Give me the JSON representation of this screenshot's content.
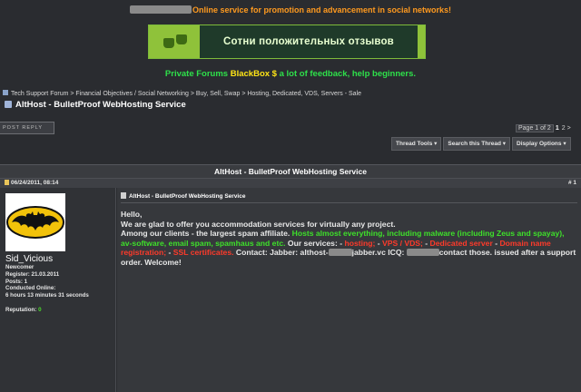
{
  "top_ad": {
    "text": "Online service for promotion and advancement in social networks!"
  },
  "banner": {
    "text": "Сотни положительных отзывов"
  },
  "private_line": {
    "part1": "Private Forums ",
    "brand": "BlackBox $",
    "part2": " a lot of feedback, help beginners."
  },
  "breadcrumb": {
    "text": "Tech Support Forum > Financial Objectives / Social Networking > Buy, Sell, Swap > Hosting, Dedicated, VDS, Servers - Sale"
  },
  "page_title": "AltHost - BulletProof WebHosting Service",
  "post_reply_label": "POST REPLY",
  "pagenav": {
    "label": "Page 1 of 2",
    "current": "1",
    "next_page": "2",
    "next_arrow": ">"
  },
  "tools": {
    "thread_tools": "Thread Tools",
    "search_thread": "Search this Thread",
    "display_options": "Display Options"
  },
  "thread_header": "AltHost - BulletProof WebHosting Service",
  "post": {
    "date": "06/24/2011, 08:14",
    "number": "# 1",
    "title": "AltHost - BulletProof WebHosting Service",
    "user": {
      "name": "Sid_Vicious",
      "rank": "Newcomer",
      "register": "Register: 21.03.2011",
      "posts": "Posts: 1",
      "conducted_label": "Conducted Online:",
      "conducted_value": "6 hours 13 minutes 31 seconds",
      "reputation_label": "Reputation:",
      "reputation_value": "0"
    },
    "body": {
      "greeting": "Hello,",
      "line1": "We are glad to offer you accommodation services for virtually any project.",
      "line2a": "Among our clients - the largest spam affiliate. ",
      "line2b": "Hosts almost everything, including malware (including Zeus and spayay), av-software, email spam, spamhaus and etc.",
      "line2c": " Our services: - ",
      "hosting": "hosting;",
      "sep1": " - ",
      "vps": "VPS / VDS;",
      "sep2": " - ",
      "dedicated": "Dedicated server",
      "sep3": " - ",
      "domain": "Domain name registration;",
      "sep4": " - ",
      "ssl": "SSL certificates.",
      "contact_a": " Contact: Jabber: althost-",
      "contact_b": "jabber.vc ICQ: ",
      "contact_c": "contact those. issued after a support order. Welcome!"
    }
  },
  "colors": {
    "background": "#2a2c30",
    "ad_orange": "#ff9a1f",
    "link_green": "#3ee02a",
    "warn_red": "#ff3a2a",
    "brand_yellow": "#ffe516"
  }
}
